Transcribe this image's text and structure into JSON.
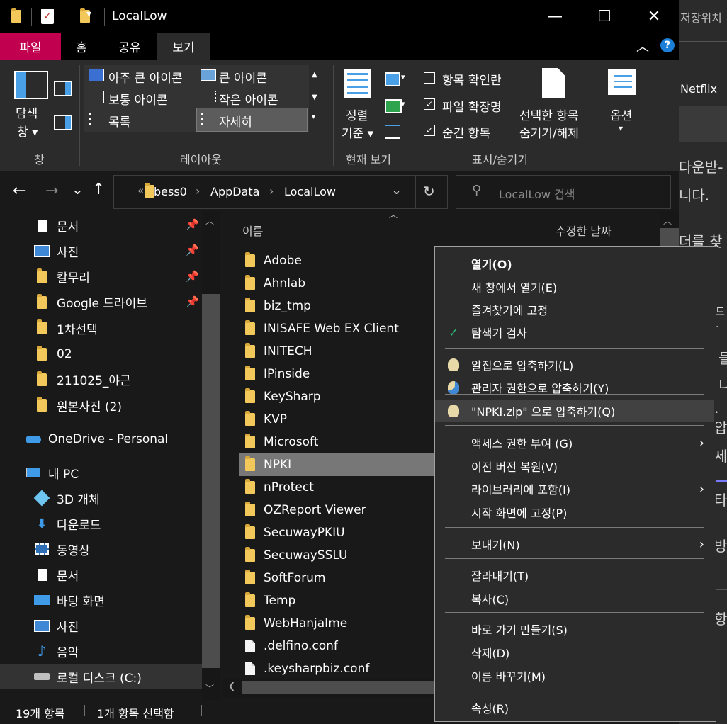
{
  "window": {
    "title": "LocalLow",
    "minimize_glyph": "—",
    "maximize_glyph": "☐",
    "close_glyph": "✕"
  },
  "background_app": {
    "texts": [
      "저장위치",
      "Netflix",
      "다운받-",
      "니다.",
      "더를 찾",
      "드 .",
      "들",
      "니",
      ". 압",
      "세,",
      "타",
      "방",
      "항"
    ]
  },
  "ribbon": {
    "tabs": [
      "파일",
      "홈",
      "공유",
      "보기"
    ],
    "active_tab": "보기",
    "panes": {
      "label_line1": "탐색",
      "label_line2": "창 ▾",
      "group": "창"
    },
    "layout": {
      "items": [
        "아주 큰 아이콘",
        "큰 아이콘",
        "보통 아이콘",
        "작은 아이콘",
        "목록",
        "자세히"
      ],
      "selected": "자세히",
      "group": "레이아웃"
    },
    "current_view": {
      "sort_line1": "정렬",
      "sort_line2": "기준 ▾",
      "group": "현재 보기"
    },
    "show_hide": {
      "checkboxes": [
        {
          "label": "항목 확인란",
          "checked": false
        },
        {
          "label": "파일 확장명",
          "checked": true
        },
        {
          "label": "숨긴 항목",
          "checked": true
        }
      ],
      "hide_selected_line1": "선택한 항목",
      "hide_selected_line2": "숨기기/해제",
      "group": "표시/숨기기"
    },
    "options": {
      "label": "옵션",
      "arrow": "▾"
    }
  },
  "address": {
    "back": "←",
    "forward": "→",
    "recent": "⌄",
    "up": "↑",
    "prefix": "«",
    "crumbs": [
      "bess0",
      "AppData",
      "LocalLow"
    ],
    "separator": "›",
    "search_placeholder": "LocalLow 검색"
  },
  "nav": {
    "items": [
      {
        "label": "문서",
        "icon": "document-icon",
        "pinned": true
      },
      {
        "label": "사진",
        "icon": "pictures-icon",
        "pinned": true
      },
      {
        "label": "칼무리",
        "icon": "folder-icon",
        "pinned": true
      },
      {
        "label": "Google 드라이브",
        "icon": "folder-icon",
        "pinned": true
      },
      {
        "label": "1차선택",
        "icon": "folder-icon",
        "pinned": false
      },
      {
        "label": "02",
        "icon": "folder-icon",
        "pinned": false
      },
      {
        "label": "211025_야근",
        "icon": "folder-icon",
        "pinned": false
      },
      {
        "label": "원본사진 (2)",
        "icon": "folder-icon",
        "pinned": false
      }
    ],
    "onedrive": "OneDrive - Personal",
    "this_pc": "내 PC",
    "pc_items": [
      {
        "label": "3D 개체",
        "icon": "3d-objects-icon"
      },
      {
        "label": "다운로드",
        "icon": "downloads-icon"
      },
      {
        "label": "동영상",
        "icon": "videos-icon"
      },
      {
        "label": "문서",
        "icon": "document-icon"
      },
      {
        "label": "바탕 화면",
        "icon": "desktop-icon"
      },
      {
        "label": "사진",
        "icon": "pictures-icon"
      },
      {
        "label": "음악",
        "icon": "music-icon"
      },
      {
        "label": "로컬 디스크 (C:)",
        "icon": "drive-icon"
      }
    ]
  },
  "list": {
    "col_name": "이름",
    "col_date": "수정한 날짜",
    "rows": [
      {
        "name": "Adobe",
        "type": "folder"
      },
      {
        "name": "Ahnlab",
        "type": "folder"
      },
      {
        "name": "biz_tmp",
        "type": "folder"
      },
      {
        "name": "INISAFE Web EX Client",
        "type": "folder"
      },
      {
        "name": "INITECH",
        "type": "folder"
      },
      {
        "name": "IPinside",
        "type": "folder"
      },
      {
        "name": "KeySharp",
        "type": "folder"
      },
      {
        "name": "KVP",
        "type": "folder"
      },
      {
        "name": "Microsoft",
        "type": "folder"
      },
      {
        "name": "NPKI",
        "type": "folder",
        "selected": true
      },
      {
        "name": "nProtect",
        "type": "folder"
      },
      {
        "name": "OZReport Viewer",
        "type": "folder"
      },
      {
        "name": "SecuwayPKIU",
        "type": "folder"
      },
      {
        "name": "SecuwaySSLU",
        "type": "folder"
      },
      {
        "name": "SoftForum",
        "type": "folder"
      },
      {
        "name": "Temp",
        "type": "folder"
      },
      {
        "name": "WebHanjaIme",
        "type": "folder"
      },
      {
        "name": ".delfino.conf",
        "type": "file"
      },
      {
        "name": ".keysharpbiz.conf",
        "type": "file"
      }
    ]
  },
  "status": {
    "count": "19개 항목",
    "selected": "1개 항목 선택함",
    "divider": "|"
  },
  "context_menu": {
    "items": [
      {
        "label": "열기(O)",
        "bold": true
      },
      {
        "label": "새 창에서 열기(E)"
      },
      {
        "label": "즐겨찾기에 고정"
      },
      {
        "label": "탐색기 검사",
        "icon": "defender-icon"
      },
      {
        "label": "알집으로 압축하기(L)",
        "icon": "alzip-icon"
      },
      {
        "label": "관리자 권한으로 압축하기(Y)",
        "icon": "alzip-admin-icon"
      },
      {
        "label": "\"NPKI.zip\" 으로 압축하기(Q)",
        "icon": "alzip-icon",
        "highlighted": true
      },
      {
        "label": "액세스 권한 부여 (G)",
        "submenu": true
      },
      {
        "label": "이전 버전 복원(V)"
      },
      {
        "label": "라이브러리에 포함(I)",
        "submenu": true
      },
      {
        "label": "시작 화면에 고정(P)"
      },
      {
        "label": "보내기(N)",
        "submenu": true
      },
      {
        "label": "잘라내기(T)"
      },
      {
        "label": "복사(C)"
      },
      {
        "label": "바로 가기 만들기(S)"
      },
      {
        "label": "삭제(D)"
      },
      {
        "label": "이름 바꾸기(M)"
      },
      {
        "label": "속성(R)"
      }
    ],
    "submenu_arrow": "›"
  }
}
